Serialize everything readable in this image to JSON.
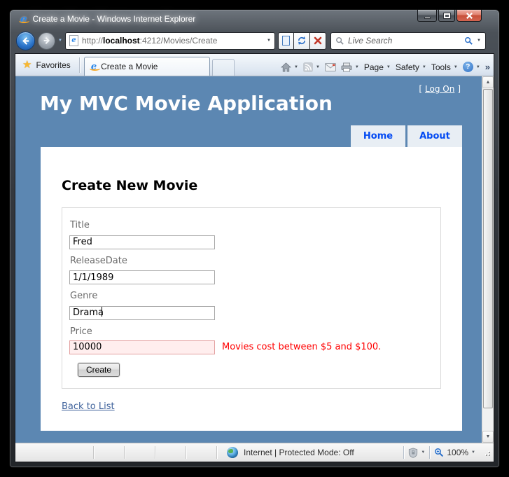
{
  "window": {
    "title": "Create a Movie - Windows Internet Explorer"
  },
  "browser": {
    "address": {
      "prefix": "http://",
      "host": "localhost",
      "path": ":4212/Movies/Create"
    },
    "search_placeholder": "Live Search",
    "favorites_label": "Favorites",
    "tab_title": "Create a Movie",
    "menus": {
      "page": "Page",
      "safety": "Safety",
      "tools": "Tools"
    }
  },
  "page": {
    "logon": {
      "open": "[",
      "label": "Log On",
      "close": "]"
    },
    "app_title": "My MVC Movie Application",
    "nav": [
      {
        "label": "Home"
      },
      {
        "label": "About"
      }
    ],
    "heading": "Create New Movie",
    "form": {
      "fields": [
        {
          "label": "Title",
          "value": "Fred"
        },
        {
          "label": "ReleaseDate",
          "value": "1/1/1989"
        },
        {
          "label": "Genre",
          "value": "Drama"
        },
        {
          "label": "Price",
          "value": "10000",
          "error": "Movies cost between $5 and $100."
        }
      ],
      "submit_label": "Create"
    },
    "back_link": "Back to List"
  },
  "statusbar": {
    "zone": "Internet | Protected Mode: Off",
    "zoom": "100%"
  },
  "icons": {
    "favorites_star": "★",
    "chevron_down": "▼",
    "overflow": "»",
    "help": "?",
    "ie_logo": "e",
    "scroll_up": "▲",
    "scroll_down": "▼"
  },
  "colors": {
    "header_bg": "#5c87b2",
    "nav_link": "#034af3",
    "nav_bg": "#e8eef4",
    "body_text": "#696969",
    "error_text": "#ff0000",
    "error_input_bg": "#ffeeee"
  }
}
